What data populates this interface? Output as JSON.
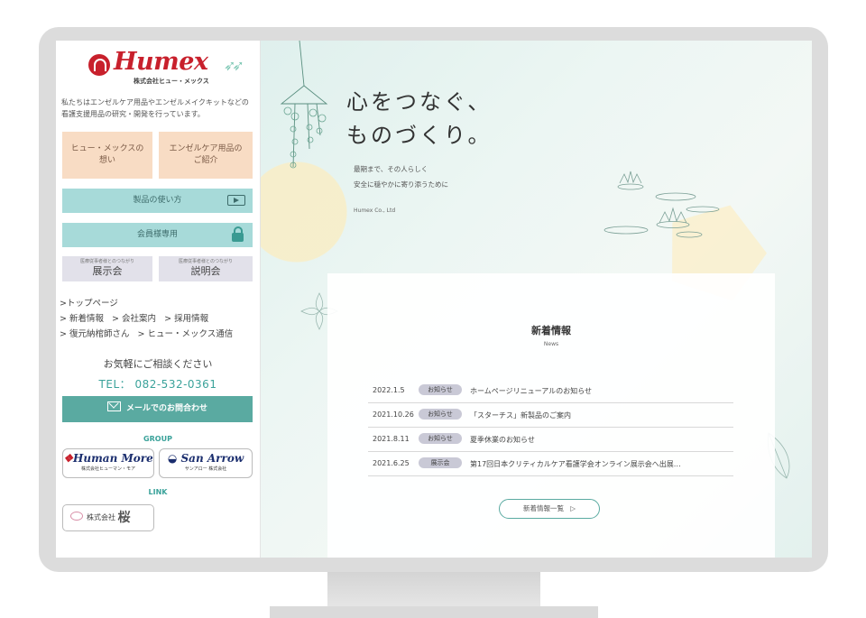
{
  "sidebar": {
    "logo_name": "Humex",
    "logo_sub": "株式会社ヒュー・メックス",
    "intro": "私たちはエンゼルケア用品やエンゼルメイクキットなどの看護支援用品の研究・開発を行っています。",
    "btn_thoughts": [
      "ヒュー・メックスの",
      "想い"
    ],
    "btn_products": [
      "エンゼルケア用品の",
      "ご紹介"
    ],
    "btn_howto": "製品の使い方",
    "btn_member": "会員様専用",
    "btn_exhibit_small": "医療従事者様とのつながり",
    "btn_exhibit": "展示会",
    "btn_briefing_small": "医療従事者様とのつながり",
    "btn_briefing": "説明会",
    "nav": {
      "top": ">トップページ",
      "news": "> 新着情報",
      "company": "> 会社案内",
      "recruit": "> 採用情報",
      "mortician": "> 復元納棺師さん",
      "letter": "> ヒュー・メックス通信"
    },
    "consult": "お気軽にご相談ください",
    "tel": "TEL： 082-532-0361",
    "mail_btn": "メールでのお問合わせ",
    "group_heading": "GROUP",
    "group1_name": "Human More",
    "group1_sub": "株式会社ヒューマン・モア",
    "group2_name": "San Arrow",
    "group2_sub": "サンアロー 株式会社",
    "link_heading": "LINK",
    "link1_prefix": "株式会社",
    "link1_kanji": "桜"
  },
  "hero": {
    "title_line1": "心をつなぐ、",
    "title_line2": "ものづくり。",
    "sub_line1": "最期まで、その人らしく",
    "sub_line2": "安全に穏やかに寄り添うために",
    "company": "Humex Co., Ltd"
  },
  "news": {
    "title": "新着情報",
    "title_en": "News",
    "items": [
      {
        "date": "2022.1.5",
        "tag": "お知らせ",
        "text": "ホームページリニューアルのお知らせ"
      },
      {
        "date": "2021.10.26",
        "tag": "お知らせ",
        "text": "「スターチス」新製品のご案内"
      },
      {
        "date": "2021.8.11",
        "tag": "お知らせ",
        "text": "夏季休業のお知らせ"
      },
      {
        "date": "2021.6.25",
        "tag": "展示会",
        "text": "第17回日本クリティカルケア看護学会オンライン展示会へ出展…"
      }
    ],
    "more": "新着情報一覧",
    "more_arrow": "▷"
  },
  "colors": {
    "brand": "#c8202c",
    "teal": "#5aaaa1",
    "peach": "#f8dcc4",
    "lightteal": "#a7dad9"
  }
}
